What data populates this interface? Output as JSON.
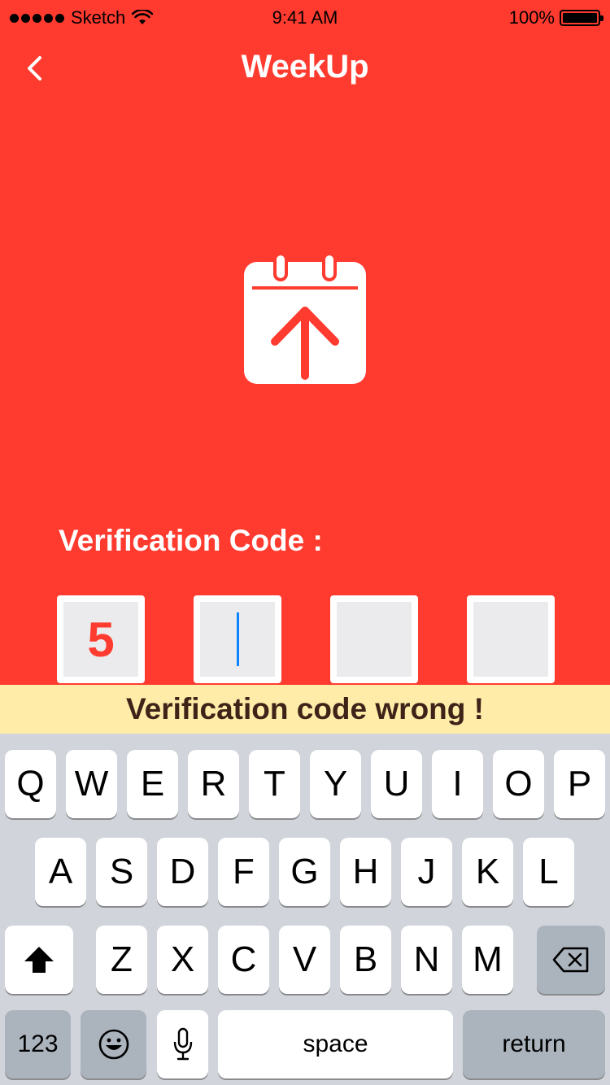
{
  "status_bar": {
    "carrier": "Sketch",
    "time": "9:41 AM",
    "battery": "100%",
    "battery_level": 1.0
  },
  "nav": {
    "title": "WeekUp",
    "back_icon": "chevron-left-icon"
  },
  "logo_icon": "calendar-upload-icon",
  "verification": {
    "label": "Verification Code :",
    "digits": [
      "5",
      "",
      "",
      ""
    ],
    "active_index": 1
  },
  "error": {
    "message": "Verification code wrong !"
  },
  "keyboard": {
    "row1": [
      "Q",
      "W",
      "E",
      "R",
      "T",
      "Y",
      "U",
      "I",
      "O",
      "P"
    ],
    "row2": [
      "A",
      "S",
      "D",
      "F",
      "G",
      "H",
      "J",
      "K",
      "L"
    ],
    "row3": [
      "Z",
      "X",
      "C",
      "V",
      "B",
      "N",
      "M"
    ],
    "shift_icon": "shift-arrow-icon",
    "backspace_icon": "backspace-icon",
    "numbers_label": "123",
    "emoji_icon": "emoji-icon",
    "mic_icon": "microphone-icon",
    "space_label": "space",
    "return_label": "return"
  },
  "colors": {
    "brand_red": "#ff3b30",
    "error_bg": "#ffeca8",
    "error_text": "#3d2318",
    "cursor": "#0a84ff"
  }
}
